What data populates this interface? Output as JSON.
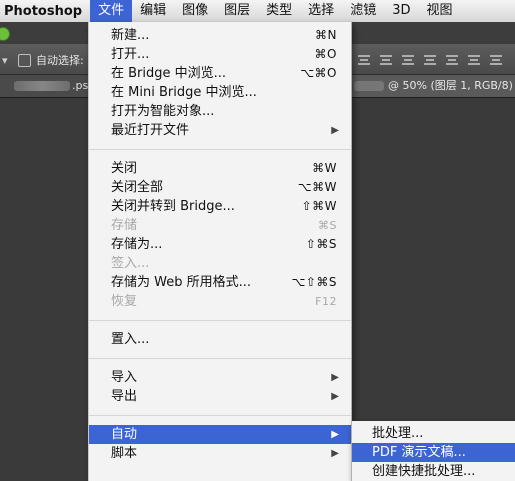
{
  "menubar": {
    "app": "Photoshop",
    "items": [
      "文件",
      "编辑",
      "图像",
      "图层",
      "类型",
      "选择",
      "滤镜",
      "3D",
      "视图"
    ]
  },
  "options_bar": {
    "autoselect_label": "自动选择:"
  },
  "doc_tabs": {
    "left_ext": ".ps",
    "right_label": "@ 50% (图层 1, RGB/8)"
  },
  "file_menu": {
    "new": {
      "label": "新建...",
      "shortcut": "⌘N"
    },
    "open": {
      "label": "打开...",
      "shortcut": "⌘O"
    },
    "browse_bridge": {
      "label": "在 Bridge 中浏览...",
      "shortcut": "⌥⌘O"
    },
    "browse_mini_bridge": {
      "label": "在 Mini Bridge 中浏览..."
    },
    "open_as_smart": {
      "label": "打开为智能对象..."
    },
    "recent": {
      "label": "最近打开文件"
    },
    "close": {
      "label": "关闭",
      "shortcut": "⌘W"
    },
    "close_all": {
      "label": "关闭全部",
      "shortcut": "⌥⌘W"
    },
    "close_go_bridge": {
      "label": "关闭并转到 Bridge...",
      "shortcut": "⇧⌘W"
    },
    "save": {
      "label": "存储",
      "shortcut": "⌘S"
    },
    "save_as": {
      "label": "存储为...",
      "shortcut": "⇧⌘S"
    },
    "check_in": {
      "label": "签入..."
    },
    "save_web": {
      "label": "存储为 Web 所用格式...",
      "shortcut": "⌥⇧⌘S"
    },
    "revert": {
      "label": "恢复",
      "shortcut": "F12"
    },
    "place": {
      "label": "置入..."
    },
    "import": {
      "label": "导入"
    },
    "export": {
      "label": "导出"
    },
    "automate": {
      "label": "自动"
    },
    "scripts": {
      "label": "脚本"
    }
  },
  "automate_submenu": {
    "batch": "批处理...",
    "pdf_presentation": "PDF 演示文稿...",
    "create_droplet": "创建快捷批处理..."
  },
  "colors": {
    "highlight": "#3c64d3"
  }
}
